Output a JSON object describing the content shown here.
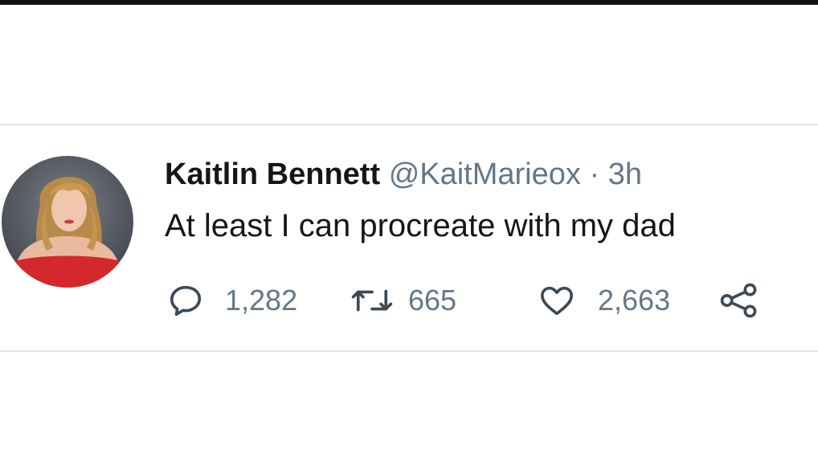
{
  "tweet": {
    "author": {
      "name": "Kaitlin Bennett",
      "handle": "@KaitMarieox",
      "separator": "·",
      "time": "3h"
    },
    "text": "At least I can procreate with my dad",
    "stats": {
      "replies": "1,282",
      "retweets": "665",
      "likes": "2,663"
    }
  },
  "icons": {
    "reply": "reply-icon",
    "retweet": "retweet-icon",
    "like": "heart-icon",
    "share": "share-icon"
  },
  "colors": {
    "text_primary": "#14171a",
    "text_secondary": "#657786",
    "divider": "#e3e6e8",
    "avatar_dress": "#d4282c"
  }
}
